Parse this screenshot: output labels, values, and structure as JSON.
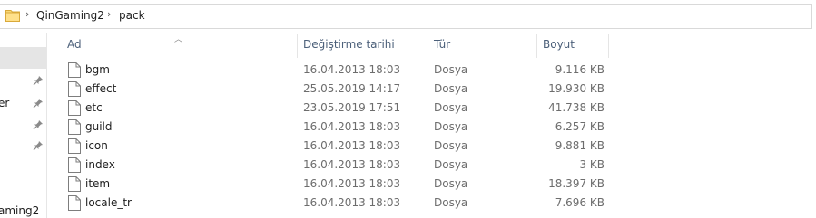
{
  "address": {
    "crumbs": [
      "QinGaming2",
      "pack"
    ]
  },
  "nav": {
    "partial_labels": [
      "er",
      "aming2"
    ]
  },
  "columns": {
    "name": "Ad",
    "date": "Değiştirme tarihi",
    "type": "Tür",
    "size": "Boyut"
  },
  "files": [
    {
      "name": "bgm",
      "date": "16.04.2013 18:03",
      "type": "Dosya",
      "size": "9.116 KB"
    },
    {
      "name": "effect",
      "date": "25.05.2019 14:17",
      "type": "Dosya",
      "size": "19.930 KB"
    },
    {
      "name": "etc",
      "date": "23.05.2019 17:51",
      "type": "Dosya",
      "size": "41.738 KB"
    },
    {
      "name": "guild",
      "date": "16.04.2013 18:03",
      "type": "Dosya",
      "size": "6.257 KB"
    },
    {
      "name": "icon",
      "date": "16.04.2013 18:03",
      "type": "Dosya",
      "size": "9.881 KB"
    },
    {
      "name": "index",
      "date": "16.04.2013 18:03",
      "type": "Dosya",
      "size": "3 KB"
    },
    {
      "name": "item",
      "date": "16.04.2013 18:03",
      "type": "Dosya",
      "size": "18.397 KB"
    },
    {
      "name": "locale_tr",
      "date": "16.04.2013 18:03",
      "type": "Dosya",
      "size": "7.696 KB"
    }
  ],
  "icons": {
    "folder": "folder-icon",
    "file": "file-icon",
    "pin": "pin-icon",
    "chevron": "chevron-right-icon"
  }
}
